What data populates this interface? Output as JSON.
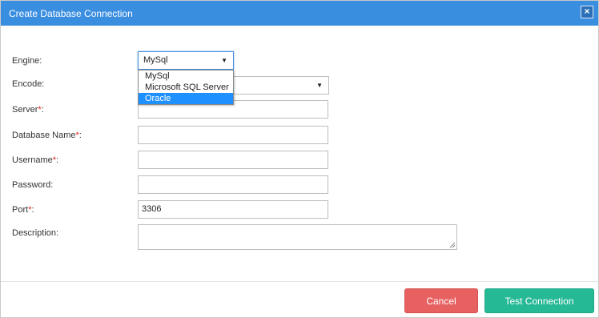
{
  "dialog": {
    "title": "Create Database Connection",
    "close_symbol": "×"
  },
  "form": {
    "required_marker": "*",
    "engine": {
      "label": "Engine:",
      "value": "MySql",
      "options": [
        "MySql",
        "Microsoft SQL Server",
        "Oracle"
      ],
      "highlighted_option": "Oracle"
    },
    "encode": {
      "label": "Encode:",
      "value": ""
    },
    "server": {
      "label": "Server",
      "suffix": ":",
      "value": ""
    },
    "database_name": {
      "label": "Database Name",
      "suffix": ":",
      "value": ""
    },
    "username": {
      "label": "Username",
      "suffix": ":",
      "value": ""
    },
    "password": {
      "label": "Password:",
      "value": ""
    },
    "port": {
      "label": "Port",
      "suffix": ":",
      "value": "3306"
    },
    "description": {
      "label": "Description:",
      "value": ""
    }
  },
  "footer": {
    "cancel_label": "Cancel",
    "test_label": "Test Connection"
  },
  "colors": {
    "titlebar": "#3a8ee0",
    "cancel": "#e76161",
    "test": "#26b996",
    "required": "#e02020",
    "highlight": "#1e90ff"
  }
}
